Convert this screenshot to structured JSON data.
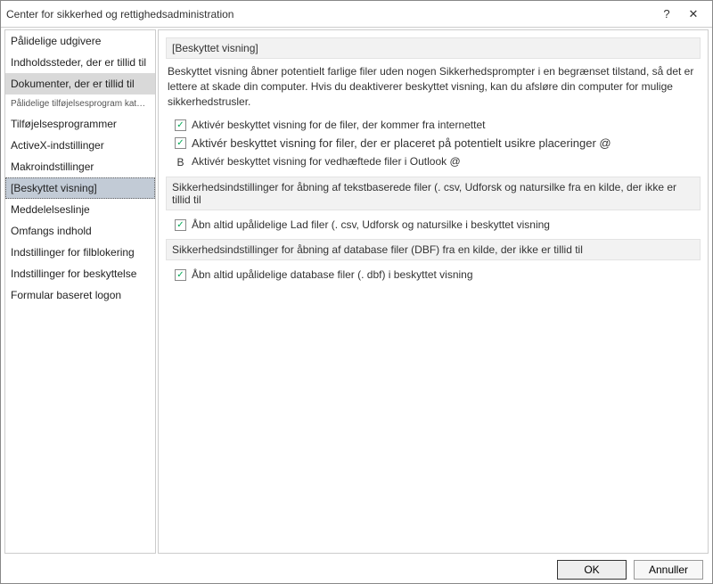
{
  "titlebar": {
    "title": "Center for sikkerhed og rettighedsadministration",
    "help_icon": "?",
    "close_icon": "✕"
  },
  "sidebar": {
    "items": [
      {
        "label": "Pålidelige udgivere"
      },
      {
        "label": "Indholdssteder, der er tillid til"
      },
      {
        "label": "Dokumenter, der er tillid til",
        "highlight": true
      },
      {
        "label": "Pålidelige tilføjelsesprogram kataloger",
        "small": true
      },
      {
        "label": "Tilføjelsesprogrammer"
      },
      {
        "label": "ActiveX-indstillinger"
      },
      {
        "label": "Makroindstillinger"
      },
      {
        "label": "[Beskyttet visning]",
        "selected": true
      },
      {
        "label": "Meddelelseslinje"
      },
      {
        "label": "Omfangs indhold"
      },
      {
        "label": "Indstillinger for filblokering"
      },
      {
        "label": "Indstillinger for beskyttelse"
      },
      {
        "label": "Formular baseret logon"
      }
    ]
  },
  "content": {
    "section1_title": "[Beskyttet visning]",
    "description": "Beskyttet visning åbner potentielt farlige filer uden nogen Sikkerhedsprompter i en begrænset tilstand, så det er lettere at skade din computer. Hvis du deaktiverer beskyttet visning, kan du afsløre din computer for mulige sikkerhedstrusler.",
    "opt1": "Aktivér beskyttet visning for de filer, der kommer fra internettet",
    "opt2": "Aktivér beskyttet visning for filer, der er placeret på potentielt usikre placeringer @",
    "opt3_bullet": "B",
    "opt3": "Aktivér beskyttet visning for vedhæftede filer i Outlook @",
    "section2_title": "Sikkerhedsindstillinger for åbning af tekstbaserede filer (. csv, Udforsk og natursilke fra en kilde, der ikke er tillid til",
    "opt4": "Åbn altid upålidelige Lad filer (. csv, Udforsk og natursilke i beskyttet visning",
    "section3_title": "Sikkerhedsindstillinger for åbning af database filer (DBF) fra en kilde, der ikke er tillid til",
    "opt5": "Åbn altid upålidelige database filer (. dbf) i beskyttet visning"
  },
  "footer": {
    "ok": "OK",
    "cancel": "Annuller"
  }
}
